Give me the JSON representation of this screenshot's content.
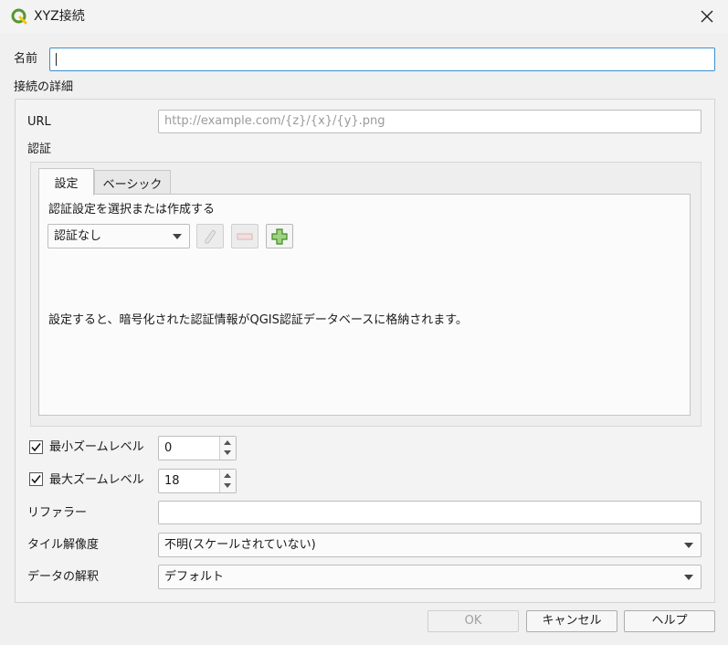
{
  "window": {
    "title": "XYZ接続",
    "close_icon": "close-icon"
  },
  "name": {
    "label": "名前",
    "value": ""
  },
  "connection": {
    "group_title": "接続の詳細",
    "url_label": "URL",
    "url_value": "",
    "url_placeholder": "http://example.com/{z}/{x}/{y}.png"
  },
  "auth": {
    "group_title": "認証",
    "tabs": [
      {
        "label": "設定",
        "active": true
      },
      {
        "label": "ベーシック",
        "active": false
      }
    ],
    "select_label": "認証設定を選択または作成する",
    "combo_value": "認証なし",
    "buttons": {
      "edit_icon": "pencil-icon",
      "remove_icon": "minus-icon",
      "add_icon": "plus-icon"
    },
    "info_text": "設定すると、暗号化された認証情報がQGIS認証データベースに格納されます。"
  },
  "zoom": {
    "min_label": "最小ズームレベル",
    "min_checked": true,
    "min_value": "0",
    "max_label": "最大ズームレベル",
    "max_checked": true,
    "max_value": "18"
  },
  "referer": {
    "label": "リファラー",
    "value": ""
  },
  "tile_resolution": {
    "label": "タイル解像度",
    "value": "不明(スケールされていない)"
  },
  "interpretation": {
    "label": "データの解釈",
    "value": "デフォルト"
  },
  "footer": {
    "ok": "OK",
    "cancel": "キャンセル",
    "help": "ヘルプ"
  },
  "colors": {
    "focus_border": "#3c8fcc",
    "qgis_green": "#589632",
    "qgis_yellow": "#eec90d"
  }
}
